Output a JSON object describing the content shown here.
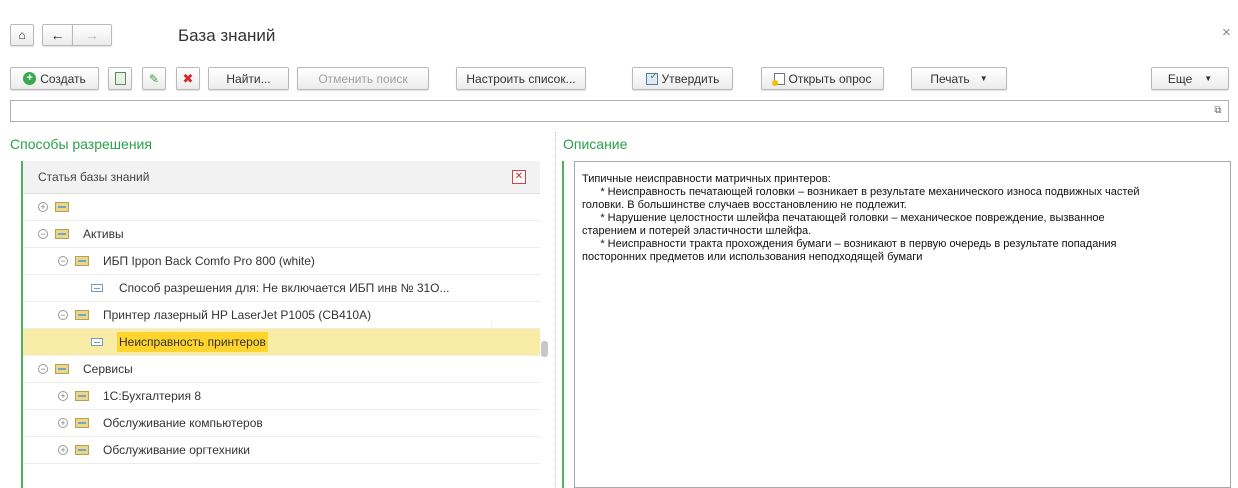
{
  "window": {
    "title": "База знаний",
    "close": "×"
  },
  "toolbar": {
    "create": "Создать",
    "find": "Найти...",
    "cancel_search": "Отменить поиск",
    "configure_list": "Настроить список...",
    "approve": "Утвердить",
    "open_survey": "Открыть опрос",
    "print": "Печать",
    "more": "Еще"
  },
  "search": {
    "value": "",
    "expand_icon": "⧉"
  },
  "left": {
    "section_title": "Способы разрешения",
    "column_header": "Статья базы знаний",
    "rows": [
      {
        "label": "",
        "expanded": false
      },
      {
        "label": "Активы",
        "expanded": true
      },
      {
        "label": "ИБП Ippon Back Comfo Pro 800 (white)",
        "expanded": true
      },
      {
        "label": "Способ разрешения для: Не включается ИБП инв № 31О..."
      },
      {
        "label": "Принтер лазерный HP LaserJet P1005 (CB410A)",
        "expanded": true
      },
      {
        "label": "Неисправность принтеров",
        "selected": true
      },
      {
        "label": "Сервисы",
        "expanded": true
      },
      {
        "label": "1С:Бухгалтерия 8",
        "expanded": false
      },
      {
        "label": "Обслуживание компьютеров",
        "expanded": false
      },
      {
        "label": "Обслуживание оргтехники",
        "expanded": false
      }
    ]
  },
  "right": {
    "section_title": "Описание",
    "lines": [
      "Типичные неисправности матричных принтеров:",
      "",
      "      * Неисправность печатающей головки – возникает в результате механического износа подвижных частей",
      "головки. В большинстве случаев восстановлению не подлежит.",
      "      * Нарушение целостности шлейфа печатающей головки – механическое повреждение, вызванное",
      "старением и потерей эластичности шлейфа.",
      "      * Неисправности тракта прохождения бумаги – возникают в первую очередь в результате попадания",
      "посторонних предметов или использования неподходящей бумаги"
    ]
  },
  "colors": {
    "accent_green": "#2aa14a",
    "selected_row": "#f9eca6",
    "highlight": "#ffd42d"
  }
}
